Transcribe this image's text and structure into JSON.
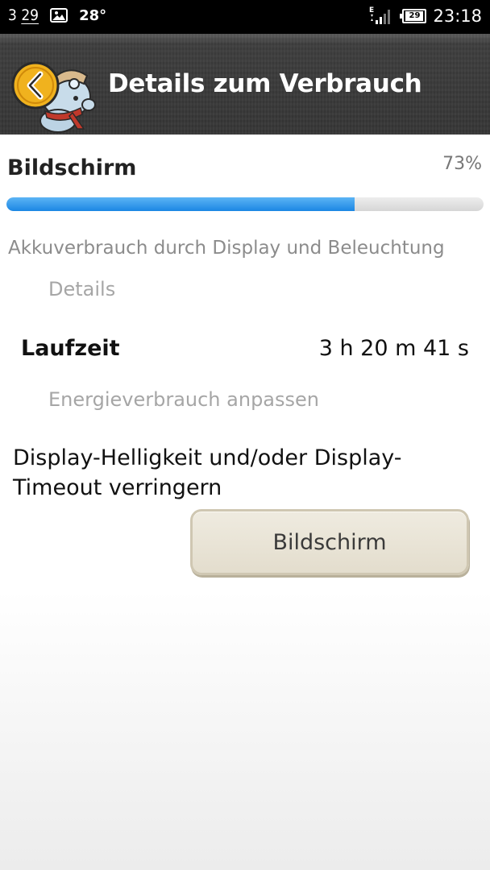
{
  "status_bar": {
    "notification_text": "3",
    "notification_underlined": "29",
    "temperature": "28°",
    "network_type": "E",
    "battery_level": "29",
    "time": "23:18",
    "icons": [
      "image-icon",
      "signal-icon",
      "battery-icon"
    ]
  },
  "header": {
    "title": "Details zum Verbrauch",
    "back_icon": "chevron-left-icon"
  },
  "usage": {
    "name": "Bildschirm",
    "percent_label": "73%",
    "percent_value": 0.73,
    "description": "Akkuverbrauch durch Display und Beleuchtung"
  },
  "details": {
    "section_title": "Details",
    "runtime_label": "Laufzeit",
    "runtime_value": "3 h 20 m 41 s"
  },
  "adjust": {
    "section_title": "Energieverbrauch anpassen",
    "suggestion": "Display-Helligkeit und/oder Display-Timeout verringern",
    "button_label": "Bildschirm"
  },
  "colors": {
    "progress_fill": "#1b86e4",
    "header_bg": "#353535",
    "button_bg": "#e8e3d5"
  }
}
